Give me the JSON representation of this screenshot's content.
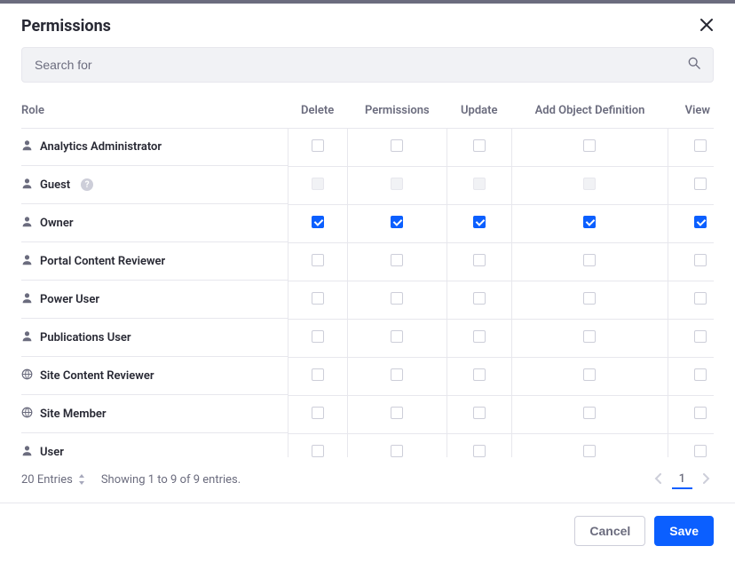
{
  "header": {
    "title": "Permissions"
  },
  "search": {
    "placeholder": "Search for"
  },
  "columns": [
    "Role",
    "Delete",
    "Permissions",
    "Update",
    "Add Object Definition",
    "View"
  ],
  "rows": [
    {
      "label": "Analytics Administrator",
      "iconType": "user",
      "help": false,
      "states": [
        "",
        "",
        "",
        "",
        ""
      ]
    },
    {
      "label": "Guest",
      "iconType": "user",
      "help": true,
      "states": [
        "disabled",
        "disabled",
        "disabled",
        "disabled",
        ""
      ]
    },
    {
      "label": "Owner",
      "iconType": "user",
      "help": false,
      "states": [
        "checked",
        "checked",
        "checked",
        "checked",
        "checked"
      ]
    },
    {
      "label": "Portal Content Reviewer",
      "iconType": "user",
      "help": false,
      "states": [
        "",
        "",
        "",
        "",
        ""
      ]
    },
    {
      "label": "Power User",
      "iconType": "user",
      "help": false,
      "states": [
        "",
        "",
        "",
        "",
        ""
      ]
    },
    {
      "label": "Publications User",
      "iconType": "user",
      "help": false,
      "states": [
        "",
        "",
        "",
        "",
        ""
      ]
    },
    {
      "label": "Site Content Reviewer",
      "iconType": "site",
      "help": false,
      "states": [
        "",
        "",
        "",
        "",
        ""
      ]
    },
    {
      "label": "Site Member",
      "iconType": "site",
      "help": false,
      "states": [
        "",
        "",
        "",
        "",
        ""
      ]
    },
    {
      "label": "User",
      "iconType": "user",
      "help": false,
      "states": [
        "",
        "",
        "",
        "",
        ""
      ]
    }
  ],
  "footer": {
    "entries_label": "20 Entries",
    "showing": "Showing 1 to 9 of 9 entries.",
    "page": "1"
  },
  "actions": {
    "cancel": "Cancel",
    "save": "Save"
  }
}
